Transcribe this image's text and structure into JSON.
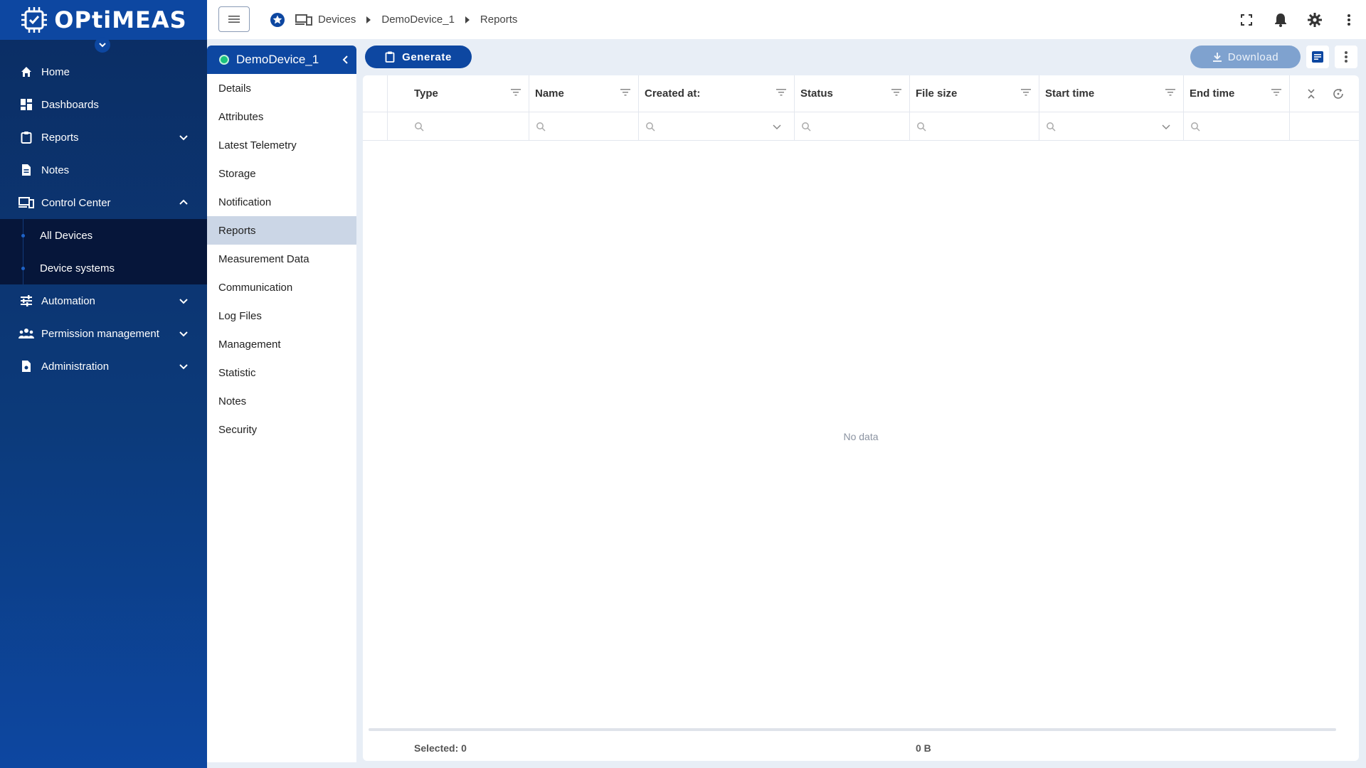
{
  "app": {
    "logo_text": "OPtiMEAS"
  },
  "nav": {
    "home": "Home",
    "dashboards": "Dashboards",
    "reports": "Reports",
    "notes": "Notes",
    "control_center": "Control Center",
    "all_devices": "All Devices",
    "device_systems": "Device systems",
    "automation": "Automation",
    "permission_management": "Permission management",
    "administration": "Administration"
  },
  "breadcrumb": {
    "devices": "Devices",
    "device": "DemoDevice_1",
    "page": "Reports"
  },
  "device_panel": {
    "title": "DemoDevice_1",
    "status": "online",
    "items": [
      {
        "label": "Details"
      },
      {
        "label": "Attributes"
      },
      {
        "label": "Latest Telemetry"
      },
      {
        "label": "Storage"
      },
      {
        "label": "Notification"
      },
      {
        "label": "Reports",
        "active": true
      },
      {
        "label": "Measurement Data"
      },
      {
        "label": "Communication"
      },
      {
        "label": "Log Files"
      },
      {
        "label": "Management"
      },
      {
        "label": "Statistic"
      },
      {
        "label": "Notes"
      },
      {
        "label": "Security"
      }
    ]
  },
  "toolbar": {
    "generate_label": "Generate",
    "download_label": "Download",
    "download_enabled": false
  },
  "grid": {
    "columns": [
      "Type",
      "Name",
      "Created at:",
      "Status",
      "File size",
      "Start time",
      "End time"
    ],
    "empty_text": "No data",
    "footer": {
      "selected": "Selected: 0",
      "total_size": "0 B"
    }
  },
  "colors": {
    "brand": "#0d47a1",
    "active_item": "#cbd6e6",
    "status_online": "#19c37d",
    "download_disabled": "#7fa2cf"
  }
}
